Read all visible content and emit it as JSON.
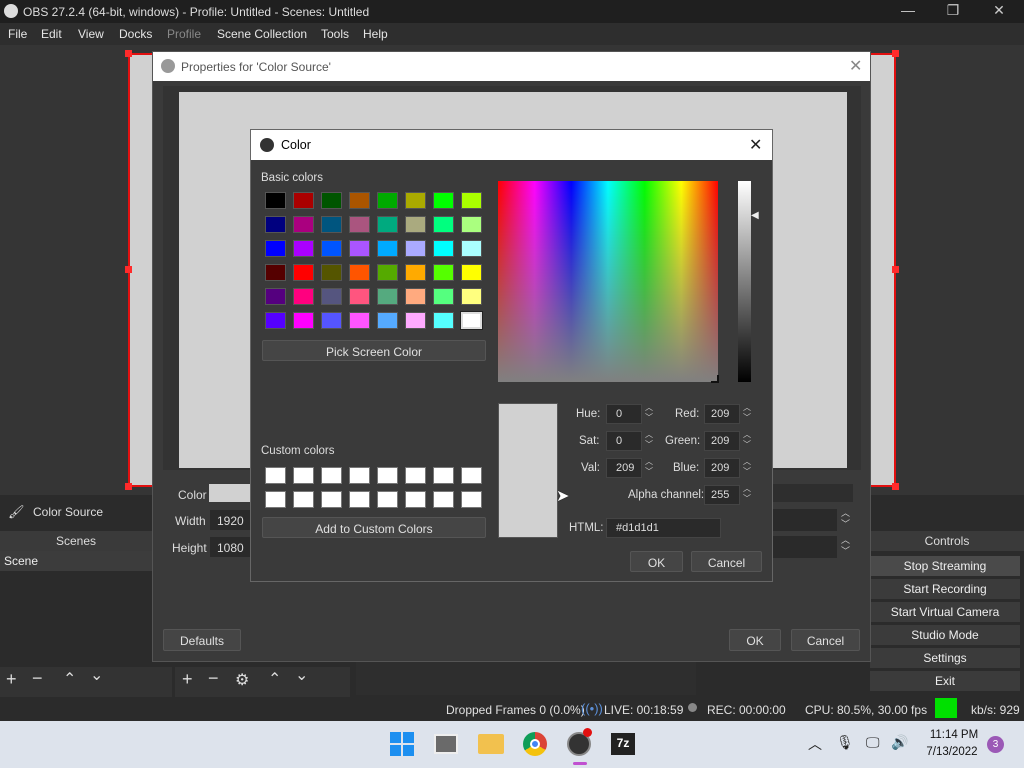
{
  "window": {
    "title": "OBS 27.2.4 (64-bit, windows) - Profile: Untitled - Scenes: Untitled",
    "min": "—",
    "max": "❐",
    "close": "✕"
  },
  "menu": [
    "File",
    "Edit",
    "View",
    "Docks",
    "Profile",
    "Scene Collection",
    "Tools",
    "Help"
  ],
  "source": {
    "name": "Color Source"
  },
  "docks": {
    "scenes": "Scenes",
    "controls": "Controls",
    "scene_item": "Scene"
  },
  "controls": [
    "Stop Streaming",
    "Start Recording",
    "Start Virtual Camera",
    "Studio Mode",
    "Settings",
    "Exit"
  ],
  "props": {
    "title": "Properties for 'Color Source'",
    "color_label": "Color",
    "width_label": "Width",
    "width_value": "1920",
    "height_label": "Height",
    "height_value": "1080",
    "defaults": "Defaults",
    "ok": "OK",
    "cancel": "Cancel"
  },
  "color_dialog": {
    "title": "Color",
    "basic_label": "Basic colors",
    "custom_label": "Custom colors",
    "pick": "Pick Screen Color",
    "add": "Add to Custom Colors",
    "hue_label": "Hue:",
    "hue": "0",
    "sat_label": "Sat:",
    "sat": "0",
    "val_label": "Val:",
    "val": "209",
    "red_label": "Red:",
    "red": "209",
    "green_label": "Green:",
    "green": "209",
    "blue_label": "Blue:",
    "blue": "209",
    "alpha_label": "Alpha channel:",
    "alpha": "255",
    "html_label": "HTML:",
    "html": "#d1d1d1",
    "ok": "OK",
    "cancel": "Cancel",
    "basic_colors": [
      "#000000",
      "#aa0000",
      "#005500",
      "#aa5500",
      "#00aa00",
      "#aaaa00",
      "#00ff00",
      "#aaff00",
      "#00007f",
      "#aa007f",
      "#00557f",
      "#aa557f",
      "#00aa7f",
      "#aaaa7f",
      "#00ff7f",
      "#aaff7f",
      "#0000ff",
      "#aa00ff",
      "#0055ff",
      "#aa55ff",
      "#00aaff",
      "#aaaaff",
      "#00ffff",
      "#aaffff",
      "#550000",
      "#ff0000",
      "#555500",
      "#ff5500",
      "#55aa00",
      "#ffaa00",
      "#55ff00",
      "#ffff00",
      "#55007f",
      "#ff007f",
      "#55557f",
      "#ff557f",
      "#55aa7f",
      "#ffaa7f",
      "#55ff7f",
      "#ffff7f",
      "#5500ff",
      "#ff00ff",
      "#5555ff",
      "#ff55ff",
      "#55aaff",
      "#ffaaff",
      "#55ffff",
      "#ffffff"
    ],
    "current_color": "#d1d1d1"
  },
  "status": {
    "dropped": "Dropped Frames 0 (0.0%)",
    "live": "LIVE: 00:18:59",
    "rec": "REC: 00:00:00",
    "cpu": "CPU: 80.5%, 30.00 fps",
    "kbs": "kb/s: 929"
  },
  "taskbar": {
    "time": "11:14 PM",
    "date": "7/13/2022",
    "badge": "3",
    "app_7z": "7z"
  }
}
